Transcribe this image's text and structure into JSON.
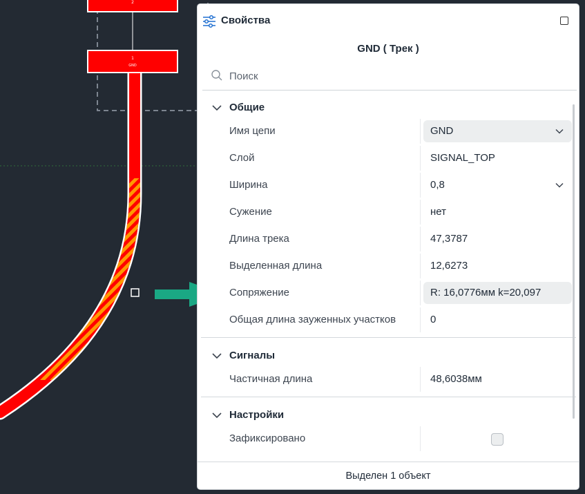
{
  "canvas": {
    "pad_top_label": "2",
    "pad_bottom_label": "1",
    "pad_bottom_net": "GND"
  },
  "colors": {
    "board_bg": "#232a33",
    "track": "#ff0000",
    "track_highlight": "#ff9900",
    "arrow": "#1aa884"
  },
  "panel": {
    "header": {
      "icon": "sliders-icon",
      "title": "Свойства",
      "maximize_icon": "maximize-icon"
    },
    "object_title": "GND ( Трек )",
    "search": {
      "icon": "search-icon",
      "placeholder": "Поиск"
    },
    "sections": {
      "general": {
        "title": "Общие",
        "rows": [
          {
            "label": "Имя цепи",
            "value": "GND",
            "dropdown": true
          },
          {
            "label": "Слой",
            "value": "SIGNAL_TOP"
          },
          {
            "label": "Ширина",
            "value": "0,8",
            "dropdown": true
          },
          {
            "label": "Сужение",
            "value": "нет"
          },
          {
            "label": "Длина трека",
            "value": "47,3787"
          },
          {
            "label": "Выделенная длина",
            "value": "12,6273"
          },
          {
            "label": "Сопряжение",
            "value": "R: 16,0776мм k=20,097"
          },
          {
            "label": "Общая длина зауженных участков",
            "value": "0"
          }
        ]
      },
      "signals": {
        "title": "Сигналы",
        "rows": [
          {
            "label": "Частичная длина",
            "value": "48,6038мм"
          }
        ]
      },
      "settings": {
        "title": "Настройки",
        "rows": [
          {
            "label": "Зафиксировано",
            "checked": false
          }
        ]
      }
    },
    "footer": "Выделен 1 объект"
  }
}
